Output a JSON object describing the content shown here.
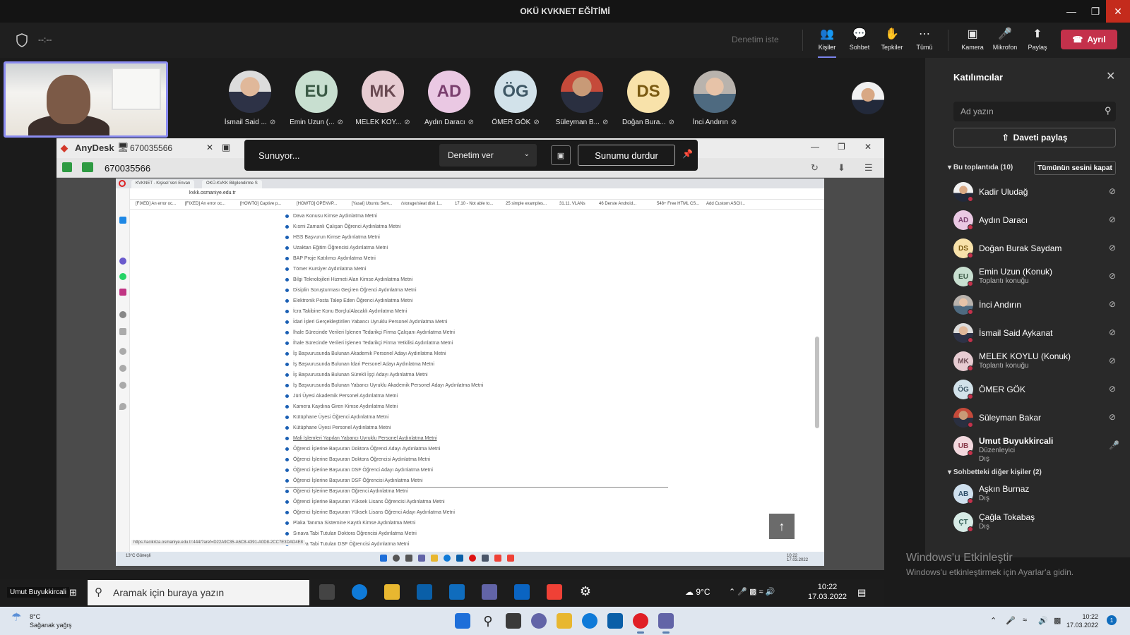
{
  "window": {
    "title": "OKÜ KVKNET EĞİTİMİ"
  },
  "toolbar": {
    "timer": "--:--",
    "request_control": "Denetim iste",
    "people": "Kişiler",
    "chat": "Sohbet",
    "reactions": "Tepkiler",
    "more": "Tümü",
    "camera": "Kamera",
    "mic": "Mikrofon",
    "share": "Paylaş",
    "leave": "Ayrıl"
  },
  "strip": [
    {
      "name": "İsmail Said ...",
      "initials": "",
      "photo": "photo"
    },
    {
      "name": "Emin Uzun (...",
      "initials": "EU",
      "bg": "#c8dfd0",
      "fg": "#3b5a46"
    },
    {
      "name": "MELEK KOY...",
      "initials": "MK",
      "bg": "#e7ccd2",
      "fg": "#6a4a52"
    },
    {
      "name": "Aydın Daracı",
      "initials": "AD",
      "bg": "#eac8e3",
      "fg": "#7a3f6e"
    },
    {
      "name": "ÖMER GÖK",
      "initials": "ÖG",
      "bg": "#d2e2ea",
      "fg": "#3f5866"
    },
    {
      "name": "Süleyman B...",
      "initials": "",
      "photo": "photo2"
    },
    {
      "name": "Doğan Bura...",
      "initials": "DS",
      "bg": "#f8e2aa",
      "fg": "#7a5a12"
    },
    {
      "name": "İnci Andırın",
      "initials": "",
      "photo": "photo3"
    }
  ],
  "presenting": {
    "label": "Sunuyor...",
    "give_control": "Denetim ver",
    "stop": "Sunumu durdur"
  },
  "anydesk": {
    "app": "AnyDesk",
    "tab_id": "670035566",
    "addr_id": "670035566"
  },
  "browser": {
    "tab1": "KVKNET - Kişisel Veri Envan",
    "tab2": "OKÜ-KVKK Bilgilendirme S",
    "url": "kvkk.osmaniye.edu.tr",
    "bookmarks": [
      "[FIXED] An error oc...",
      "[FIXED] An error oc...",
      "[HOWTO] Captive p...",
      "[HOWTO] OPENVP...",
      "[Yasal] Ubuntu Serv...",
      "/storage/sieat disk 1...",
      "17.10 - Not able to...",
      "25 simple examples...",
      "31.11. VLANs",
      "46 Derste Android...",
      "548+ Free HTML CS...",
      "Add Custom ASCII..."
    ],
    "items": [
      "Dava Konusu Kimse Aydınlatma Metni",
      "Kısmi Zamanlı Çalışan Öğrenci Aydınlatma Metni",
      "HSS Başvurun Kimse Aydınlatma Metni",
      "Uzaktan Eğitim Öğrencisi Aydınlatma Metni",
      "BAP Proje Katılımcı Aydınlatma Metni",
      "Tömer Kursiyer Aydınlatma Metni",
      "Bilgi Teknolojileri Hizmeti Alan Kimse Aydınlatma Metni",
      "Disiplin Soruşturması Geçiren Öğrenci Aydınlatma Metni",
      "Elektronik Posta Talep Eden Öğrenci Aydınlatma Metni",
      "İcra Takibine Konu Borçlu/Alacaklı Aydınlatma Metni",
      "İdari İşleri Gerçekleştirilen Yabancı Uyruklu Personel Aydınlatma Metni",
      "İhale Sürecinde Verileri İşlenen Tedarikçi Firma Çalışanı Aydınlatma Metni",
      "İhale Sürecinde Verileri İşlenen Tedarikçi Firma Yetkilisi Aydınlatma Metni",
      "İş Başvurusunda Bulunan Akademik Personel Adayı Aydınlatma Metni",
      "İş Başvurusunda Bulunan İdari Personel Adayı Aydınlatma Metni",
      "İş Başvurusunda Bulunan Sürekli İşçi Adayı Aydınlatma Metni",
      "İş Başvurusunda Bulunan Yabancı Uyruklu Akademik Personel Adayı Aydınlatma Metni",
      "Jüri Üyesi Akademik Personel Aydınlatma Metni",
      "Kamera Kaydına Giren Kimse Aydınlatma Metni",
      "Kütüphane Üyesi Öğrenci Aydınlatma Metni",
      "Kütüphane Üyesi Personel Aydınlatma Metni",
      "Mali İşlemleri Yapılan Yabancı Uyruklu Personel Aydınlatma Metni",
      "Öğrenci İşlerine Başvuran Doktora Öğrenci Adayı Aydınlatma Metni",
      "Öğrenci İşlerine Başvuran Doktora Öğrencisi Aydınlatma Metni",
      "Öğrenci İşlerine Başvuran DSF Öğrenci Adayı Aydınlatma Metni",
      "Öğrenci İşlerine Başvuran DSF Öğrencisi Aydınlatma Metni",
      "Öğrenci İşlerine Başvuran Öğrenci Aydınlatma Metni",
      "Öğrenci İşlerine Başvuran Yüksek Lisans Öğrencisi Aydınlatma Metni",
      "Öğrenci İşlerine Başvuran Yüksek Lisans Öğrenci Adayı Aydınlatma Metni",
      "Plaka Tanıma Sistemine Kayıtlı Kimse Aydınlatma Metni",
      "Sınava Tabi Tutulan Doktora Öğrencisi Aydınlatma Metni",
      "Sınava Tabi Tutulan DSF Öğrencisi Aydınlatma Metni"
    ],
    "status_url": "https://acikriza.osmaniye.edu.tr:444/?aref=D22A9C35-A6C8-4391-A0D8-2CC7E3DAD4E8",
    "remote_weather": "13°C Güneşli",
    "remote_time": "10:22",
    "remote_date": "17.03.2022"
  },
  "host_taskbar": {
    "user": "Umut Buyukkircali",
    "search": "Aramak için buraya yazın",
    "weather": "9°C",
    "time": "10:22",
    "date": "17.03.2022"
  },
  "panel": {
    "title": "Katılımcılar",
    "search_placeholder": "Ad yazın",
    "share_invite": "Daveti paylaş",
    "in_meeting": "Bu toplantıda (10)",
    "mute_all": "Tümünün sesini kapat",
    "participants": [
      {
        "name": "Kadir Uludağ",
        "sub": "",
        "initials": "",
        "photo": "photo4"
      },
      {
        "name": "Aydın Daracı",
        "sub": "",
        "initials": "AD",
        "bg": "#eac8e3",
        "fg": "#7a3f6e"
      },
      {
        "name": "Doğan Burak Saydam",
        "sub": "",
        "initials": "DS",
        "bg": "#f8e2aa",
        "fg": "#7a5a12"
      },
      {
        "name": "Emin Uzun (Konuk)",
        "sub": "Toplantı konuğu",
        "initials": "EU",
        "bg": "#c8dfd0",
        "fg": "#3b5a46"
      },
      {
        "name": "İnci Andırın",
        "sub": "",
        "initials": "",
        "photo": "photo3"
      },
      {
        "name": "İsmail Said Aykanat",
        "sub": "",
        "initials": "",
        "photo": "photo"
      },
      {
        "name": "MELEK KOYLU (Konuk)",
        "sub": "Toplantı konuğu",
        "initials": "MK",
        "bg": "#e7ccd2",
        "fg": "#6a4a52"
      },
      {
        "name": "ÖMER GÖK",
        "sub": "",
        "initials": "ÖG",
        "bg": "#d2e2ea",
        "fg": "#3f5866"
      },
      {
        "name": "Süleyman Bakar",
        "sub": "",
        "initials": "",
        "photo": "photo2"
      },
      {
        "name": "Umut Buyukkircali",
        "sub": "Düzenleyici",
        "sub2": "Dış",
        "initials": "UB",
        "bg": "#f2d8de",
        "fg": "#8a3b4c"
      }
    ],
    "others_head": "Sohbetteki diğer kişiler (2)",
    "others": [
      {
        "name": "Aşkın Burnaz",
        "sub": "Dış",
        "initials": "AB",
        "bg": "#cfe0ee",
        "fg": "#2f4f6a"
      },
      {
        "name": "Çağla Tokabaş",
        "sub": "Dış",
        "initials": "ÇT",
        "bg": "#d7ebe6",
        "fg": "#2f5a52"
      }
    ]
  },
  "watermark": {
    "title": "Windows'u Etkinleştir",
    "sub": "Windows'u etkinleştirmek için Ayarlar'a gidin."
  },
  "taskbar": {
    "temp": "8°C",
    "weather": "Sağanak yağış",
    "time": "10:22",
    "date": "17.03.2022",
    "notifications": "1"
  }
}
